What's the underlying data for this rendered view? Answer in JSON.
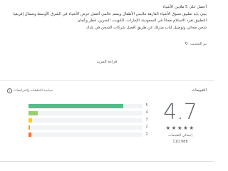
{
  "description": {
    "lines": [
      "أحصل على 5 ملايين الأشياء",
      "بيني بايه تطبيق تسوق الأشياء الفارهة ملابس الأطفال ويضم عالمي أفضل عرض الأشياء في الشرق الأوسط وشمال إفريقيا",
      "التطبيق تفرد الاستلام مجاناً في السعودية، الإمارات، الكويت، البحرين، قطر وعُمان",
      "شحن مجاني وتوصيل لباب منزلك عن طريق أفضل شركات الشحن في بلدك"
    ]
  },
  "updated": {
    "text": "تم التحديث",
    "icon": "refresh-icon"
  },
  "read_more": "قراءة المزيد",
  "ratings": {
    "title": "التقييمات",
    "info_label": "سياسة التعليقات والمراجعات",
    "score": "4.7",
    "stars_display": "★★★★★",
    "total_label": "إجمالي التقييمات",
    "count": "110,988",
    "distribution": [
      {
        "stars": "5",
        "fraction": 0.83,
        "color": "#57bb8a"
      },
      {
        "stars": "4",
        "fraction": 0.08,
        "color": "#9ace6a"
      },
      {
        "stars": "3",
        "fraction": 0.03,
        "color": "#ffcf02"
      },
      {
        "stars": "2",
        "fraction": 0.015,
        "color": "#ff9f02"
      },
      {
        "stars": "1",
        "fraction": 0.025,
        "color": "#ff6f31"
      }
    ]
  }
}
